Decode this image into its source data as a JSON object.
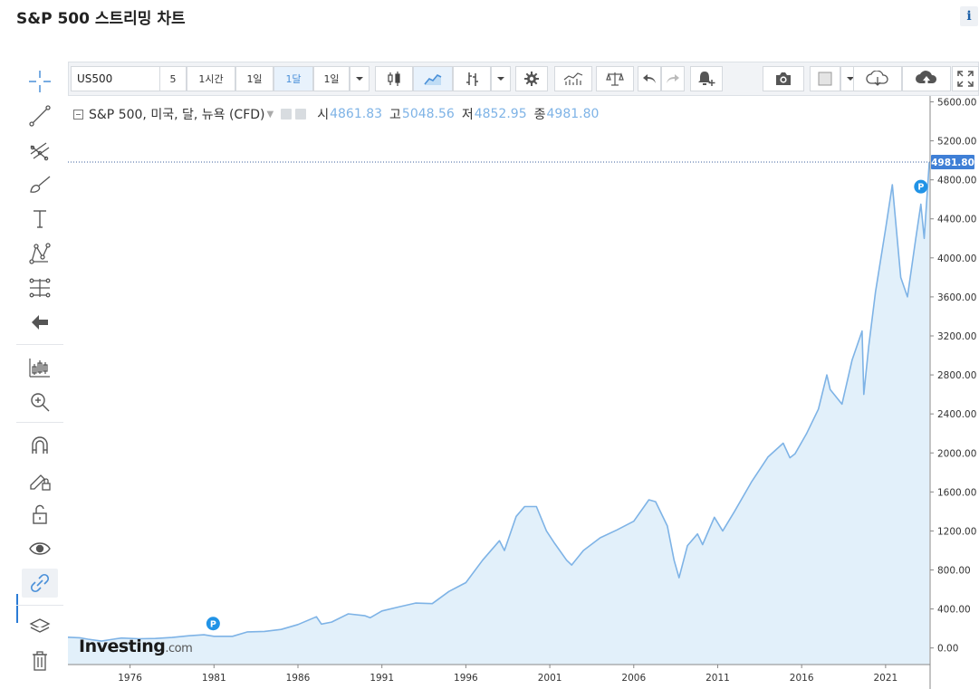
{
  "page": {
    "title": "S&P 500 스트리밍 차트",
    "info_icon": "i"
  },
  "toolbar": {
    "symbol": "US500",
    "intervals": [
      "5",
      "1시간",
      "1일",
      "1달",
      "1일"
    ],
    "active_interval": "1달",
    "icons": [
      "dropdown-icon",
      "candlestick-icon",
      "line-chart-icon",
      "bar-chart-icon",
      "dropdown-icon",
      "settings-icon",
      "indicators-icon",
      "compare-icon",
      "undo-icon",
      "redo-icon",
      "alert-icon",
      "camera-icon",
      "color-swatch-icon",
      "dropdown-icon",
      "cloud-download-icon",
      "cloud-upload-icon",
      "fullscreen-icon"
    ]
  },
  "left_tools": [
    "crosshair-icon",
    "trend-line-icon",
    "pitchfork-icon",
    "brush-icon",
    "text-icon",
    "pattern-icon",
    "measure-icon",
    "back-arrow-icon",
    "chart-style-icon",
    "zoom-icon",
    "magnet-icon",
    "lock-drawing-icon",
    "unlock-icon",
    "eye-icon",
    "link-icon",
    "layers-icon",
    "trash-icon"
  ],
  "legend": {
    "name": "S&P 500, 미국, 달, 뉴욕 (CFD)",
    "open_label": "시",
    "open": "4861.83",
    "high_label": "고",
    "high": "5048.56",
    "low_label": "저",
    "low": "4852.95",
    "close_label": "종",
    "close": "4981.80"
  },
  "watermark": {
    "brand": "Investing",
    "suffix": ".com"
  },
  "colors": {
    "line": "#7eb3e6",
    "fill": "#e2f0fa",
    "price_tag": "#3f7fd6",
    "marker": "#2193e6"
  },
  "chart_data": {
    "type": "area",
    "x_unit": "year",
    "x": [
      1972.8,
      1973.5,
      1974.0,
      1974.8,
      1975.5,
      1976.0,
      1977.0,
      1978.0,
      1979.0,
      1980.0,
      1980.9,
      1981.5,
      1982.6,
      1983.5,
      1984.5,
      1985.5,
      1986.5,
      1987.6,
      1987.9,
      1988.5,
      1989.5,
      1990.5,
      1990.8,
      1991.5,
      1992.5,
      1993.5,
      1994.5,
      1995.5,
      1996.5,
      1997.5,
      1998.5,
      1998.8,
      1999.5,
      2000.0,
      2000.7,
      2001.3,
      2001.8,
      2002.5,
      2002.8,
      2003.5,
      2004.5,
      2005.5,
      2006.5,
      2007.4,
      2007.8,
      2008.5,
      2008.9,
      2009.2,
      2009.7,
      2010.3,
      2010.6,
      2011.3,
      2011.8,
      2012.5,
      2013.5,
      2014.5,
      2015.4,
      2015.8,
      2016.1,
      2016.8,
      2017.5,
      2018.0,
      2018.2,
      2018.9,
      2019.5,
      2020.1,
      2020.2,
      2020.5,
      2020.9,
      2021.5,
      2021.9,
      2022.4,
      2022.8,
      2023.3,
      2023.6,
      2023.8,
      2024.1
    ],
    "values": [
      110,
      105,
      90,
      70,
      90,
      102,
      95,
      97,
      108,
      125,
      135,
      120,
      120,
      165,
      170,
      190,
      240,
      320,
      245,
      265,
      350,
      330,
      310,
      380,
      420,
      460,
      455,
      580,
      670,
      900,
      1100,
      1000,
      1350,
      1450,
      1450,
      1200,
      1070,
      900,
      850,
      1000,
      1130,
      1210,
      1300,
      1520,
      1500,
      1250,
      900,
      720,
      1050,
      1170,
      1060,
      1340,
      1200,
      1400,
      1700,
      1960,
      2100,
      1950,
      1990,
      2200,
      2450,
      2800,
      2650,
      2500,
      2950,
      3250,
      2600,
      3100,
      3650,
      4300,
      4750,
      3800,
      3600,
      4200,
      4550,
      4200,
      4981.8
    ],
    "ylim": [
      -170,
      5660
    ],
    "yticks": [
      0,
      400,
      800,
      1200,
      1600,
      2000,
      2400,
      2800,
      3200,
      3600,
      4000,
      4400,
      4800,
      5200,
      5600
    ],
    "ytick_labels": [
      "0.00",
      "400.00",
      "800.00",
      "1200.00",
      "1600.00",
      "2000.00",
      "2400.00",
      "2800.00",
      "3200.00",
      "3600.00",
      "4000.00",
      "4400.00",
      "4800.00",
      "5200.00",
      "5600.00"
    ],
    "xlim": [
      1972.8,
      2024.15
    ],
    "xticks": [
      "1976",
      "1981",
      "1986",
      "1991",
      "1996",
      "2001",
      "2006",
      "2011",
      "2016",
      "2021"
    ],
    "last_price": 4981.8,
    "last_price_label": "4981.80",
    "markers": [
      {
        "label": "P",
        "x": 1981.45,
        "y": 250
      },
      {
        "label": "P",
        "x": 2023.6,
        "y": 4730
      }
    ],
    "grid": false,
    "legend_position": "top-left"
  }
}
